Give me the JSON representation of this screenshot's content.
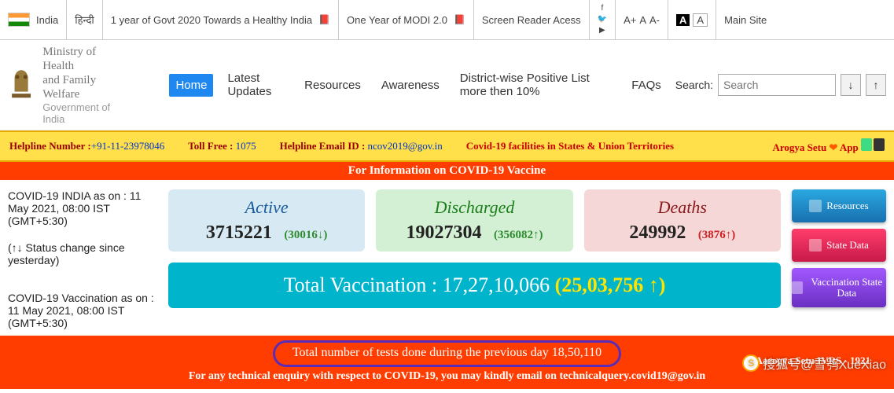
{
  "topbar": {
    "country": "India",
    "lang": "हिन्दी",
    "link1": "1 year of Govt 2020 Towards a Healthy India",
    "link2": "One Year of MODI 2.0",
    "screen_reader": "Screen Reader Acess",
    "a_plus": "A+",
    "a_norm": "A",
    "a_minus": "A-",
    "contrast_a": "A",
    "contrast_b": "A",
    "main_site": "Main Site"
  },
  "org": {
    "line1": "Ministry of Health",
    "line2": "and Family Welfare",
    "sub": "Government of India"
  },
  "nav": {
    "home": "Home",
    "latest": "Latest Updates",
    "resources": "Resources",
    "awareness": "Awareness",
    "district": "District-wise Positive List more then 10%",
    "faqs": "FAQs"
  },
  "search": {
    "label": "Search:",
    "placeholder": "Search"
  },
  "helpline": {
    "num_lbl": "Helpline Number :",
    "num_val": "+91-11-23978046",
    "toll_lbl": "Toll Free :",
    "toll_val": "1075",
    "email_lbl": "Helpline Email ID :",
    "email_val": "ncov2019@gov.in",
    "facilities": "Covid-19 facilities in States & Union Territories",
    "arogya_lbl": "Arogya Setu",
    "arogya_app": "App"
  },
  "orange_top": "For Information on COVID-19 Vaccine",
  "left": {
    "asof": "COVID-19 INDIA as on : 11 May 2021, 08:00 IST (GMT+5:30)",
    "status_note": "(↑↓ Status change since yesterday)",
    "vacc_asof": "COVID-19 Vaccination as on : 11 May 2021, 08:00 IST (GMT+5:30)"
  },
  "stats": {
    "active_lbl": "Active",
    "active_val": "3715221",
    "active_delta": "(30016↓)",
    "discharged_lbl": "Discharged",
    "discharged_val": "19027304",
    "discharged_delta": "(356082↑)",
    "deaths_lbl": "Deaths",
    "deaths_val": "249992",
    "deaths_delta": "(3876↑)"
  },
  "vacc": {
    "label": "Total Vaccination :",
    "value": "17,27,10,066",
    "delta": "(25,03,756 ↑)"
  },
  "rbtns": {
    "resources": "Resources",
    "state_data": "State Data",
    "vacc_state": "Vaccination State Data"
  },
  "footer": {
    "tests": "Total number of tests done during the previous day 18,50,110",
    "tech": "For any technical enquiry with respect to COVID-19, you may kindly email on technicalquery.covid19@gov.in",
    "ivrs": "Aarogya Setu IVRS - 1921"
  },
  "watermark": "搜狐号@雪鸮XueXiao"
}
